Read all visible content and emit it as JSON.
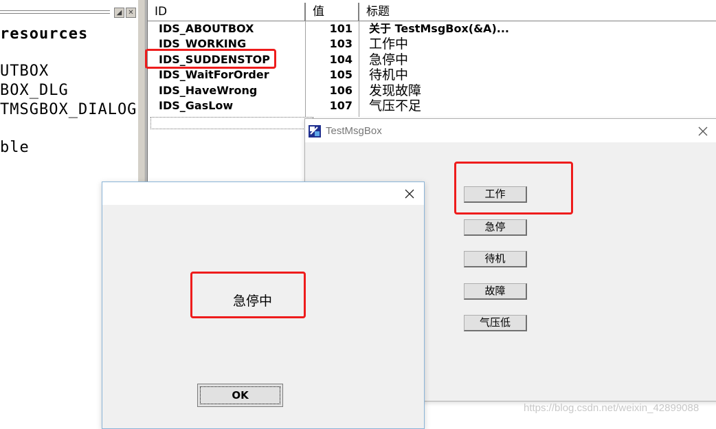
{
  "resource_tree": {
    "lines": [
      {
        "text": " resources",
        "bold": true
      },
      {
        "text": "UTBOX",
        "bold": false
      },
      {
        "text": "BOX_DLG",
        "bold": false
      },
      {
        "text": "TMSGBOX_DIALOG",
        "bold": false
      },
      {
        "text": "ble",
        "bold": false
      }
    ],
    "pin_glyph": "◢",
    "close_glyph": "✕"
  },
  "string_table": {
    "columns": [
      "ID",
      "值",
      "标题"
    ],
    "rows": [
      {
        "id": "IDS_ABOUTBOX",
        "value": "101",
        "caption": "关于 TestMsgBox(&A)..."
      },
      {
        "id": "IDS_WORKING",
        "value": "103",
        "caption": "工作中"
      },
      {
        "id": "IDS_SUDDENSTOP",
        "value": "104",
        "caption": "急停中"
      },
      {
        "id": "IDS_WaitForOrder",
        "value": "105",
        "caption": "待机中"
      },
      {
        "id": "IDS_HaveWrong",
        "value": "106",
        "caption": "发现故障"
      },
      {
        "id": "IDS_GasLow",
        "value": "107",
        "caption": "气压不足"
      }
    ]
  },
  "main_dialog": {
    "title": "TestMsgBox",
    "buttons": [
      "工作",
      "急停",
      "待机",
      "故障",
      "气压低"
    ]
  },
  "message_box": {
    "message": "急停中",
    "ok_label": "OK"
  },
  "watermark": "https://blog.csdn.net/weixin_42899088",
  "colors": {
    "highlight": "#ee1c1c",
    "dialog_bg": "#f0f0f0"
  }
}
